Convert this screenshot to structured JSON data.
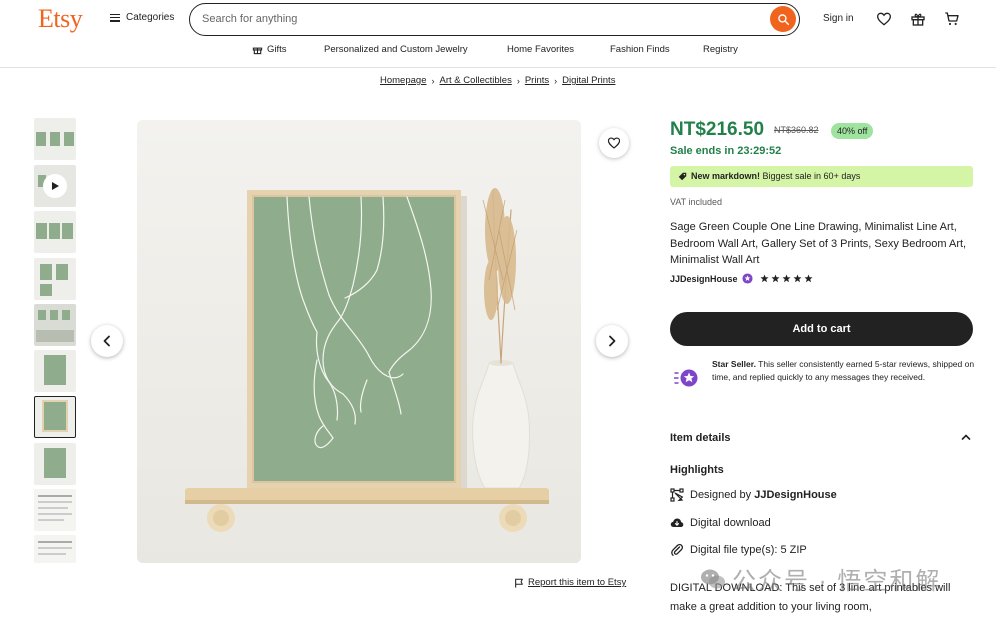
{
  "header": {
    "logo": "Etsy",
    "categories_label": "Categories",
    "search_placeholder": "Search for anything",
    "signin_label": "Sign in"
  },
  "subnav": {
    "gifts": "Gifts",
    "personalized": "Personalized and Custom Jewelry",
    "home_favorites": "Home Favorites",
    "fashion_finds": "Fashion Finds",
    "registry": "Registry"
  },
  "breadcrumb": [
    "Homepage",
    "Art & Collectibles",
    "Prints",
    "Digital Prints"
  ],
  "gallery": {
    "selected_index": 6,
    "thumb_count": 10
  },
  "report_label": "Report this item to Etsy",
  "listing": {
    "price": "NT$216.50",
    "original_price": "NT$360.82",
    "discount": "40% off",
    "sale_ends": "Sale ends in 23:29:52",
    "markdown_bold": "New markdown!",
    "markdown_text": " Biggest sale in 60+ days",
    "vat": "VAT included",
    "title": "Sage Green Couple One Line Drawing, Minimalist Line Art, Bedroom Wall Art, Gallery Set of 3 Prints, Sexy Bedroom Art, Minimalist Wall Art",
    "shop_name": "JJDesignHouse",
    "rating": 5,
    "add_to_cart": "Add to cart",
    "star_seller_bold": "Star Seller.",
    "star_seller_text": " This seller consistently earned 5-star reviews, shipped on time, and replied quickly to any messages they received.",
    "item_details": "Item details",
    "highlights_label": "Highlights",
    "designed_by_prefix": "Designed by ",
    "designed_by_shop": "JJDesignHouse",
    "digital_download": "Digital download",
    "file_types": "Digital file type(s): 5 ZIP",
    "description": "DIGITAL DOWNLOAD: This set of 3 line art printables will make a great addition to your living room,"
  },
  "watermark": "公众号 · 悟空和解",
  "colors": {
    "brand": "#f1641e",
    "price_green": "#23804a",
    "discount_bg": "#9ee39e",
    "markdown_bg": "#d4f5a6",
    "sage": "#8fac8c",
    "star_purple": "#7f45c9"
  }
}
